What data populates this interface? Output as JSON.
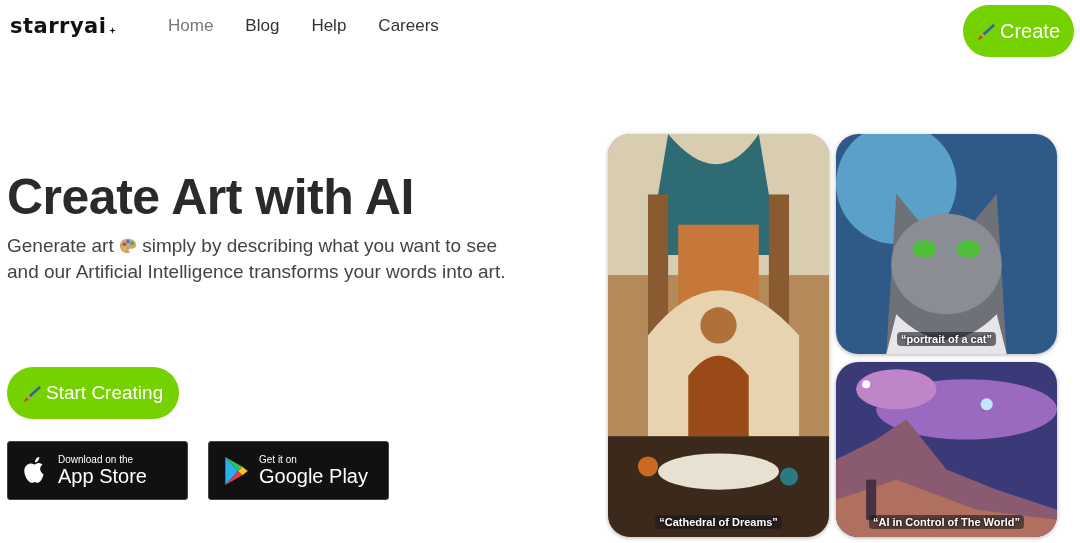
{
  "header": {
    "logo": "starryai",
    "nav": [
      {
        "label": "Home",
        "selected": true
      },
      {
        "label": "Blog",
        "selected": false
      },
      {
        "label": "Help",
        "selected": false
      },
      {
        "label": "Careers",
        "selected": false
      }
    ],
    "create_button": "Create"
  },
  "hero": {
    "title": "Create Art with AI",
    "tagline_before": "Generate art",
    "tagline_after": "simply by describing what you want to see",
    "tagline_line2": "and our Artificial Intelligence transforms your words into art.",
    "start_button": "Start Creating",
    "stores": [
      {
        "kind": "apple",
        "small": "Download on the",
        "big": "App Store"
      },
      {
        "kind": "google",
        "small": "Get it on",
        "big": "Google Play"
      }
    ]
  },
  "gallery": [
    {
      "kind": "cathedral",
      "caption": "“Cathedral of Dreams”"
    },
    {
      "kind": "cat",
      "caption": "“portrait of a cat”"
    },
    {
      "kind": "space",
      "caption": "“AI in Control of The World”"
    }
  ]
}
